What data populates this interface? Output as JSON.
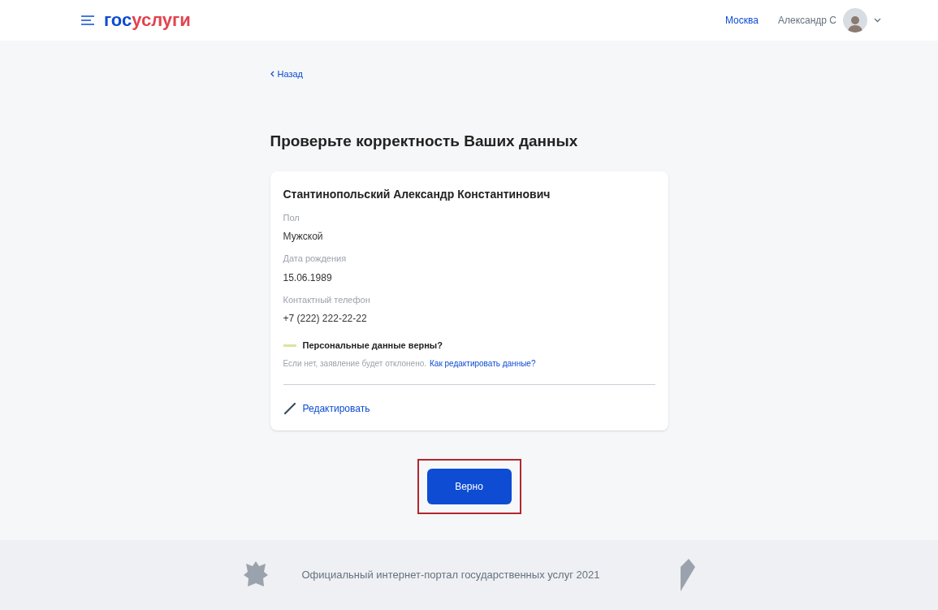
{
  "header": {
    "logo": {
      "part_1": "гос",
      "part_2": "услуги"
    },
    "city": "Москва",
    "user": "Александр С"
  },
  "back_link": "Назад",
  "title": "Проверьте корректность Ваших данных",
  "card": {
    "name": "Стантинопольский Александр Константинович",
    "fields": [
      {
        "label": "Пол",
        "value": "Мужской"
      },
      {
        "label": "Дата рождения",
        "value": "15.06.1989"
      },
      {
        "label": "Контактный телефон",
        "value": "+7 (222) 222-22-22"
      }
    ],
    "notice": {
      "title": "Персональные данные верны?",
      "text": "Если нет, заявление будет отклонено.",
      "link": "Как редактировать данные?"
    },
    "edit": "Редактировать"
  },
  "confirm_button": {
    "label": "Верно",
    "highlighted": true
  },
  "footer": {
    "text": "Официальный интернет-портал государственных услуг 2021"
  }
}
